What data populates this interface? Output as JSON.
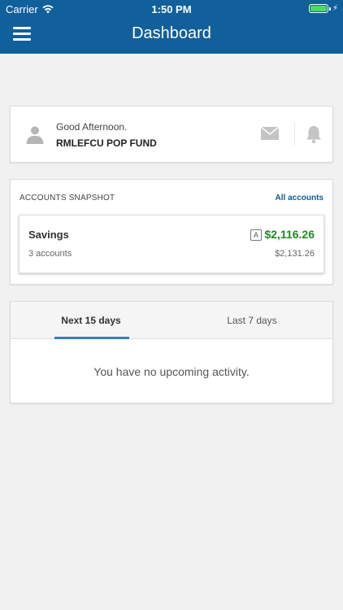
{
  "status_bar": {
    "carrier": "Carrier",
    "time": "1:50 PM",
    "battery_color": "#4cd964"
  },
  "nav": {
    "title": "Dashboard",
    "menu_icon": "hamburger-menu-icon",
    "background_color": "#11609b"
  },
  "greeting": {
    "salutation": "Good Afternoon.",
    "name": "RMLEFCU POP FUND",
    "icons": [
      "user-avatar-icon",
      "mail-icon",
      "bell-icon"
    ]
  },
  "snapshot": {
    "title": "ACCOUNTS SNAPSHOT",
    "link_label": "All accounts",
    "group": {
      "label": "Savings",
      "count": "3 accounts",
      "badge": "A",
      "available_balance": "$2,116.26",
      "current_balance": "$2,131.26",
      "balance_color": "#1f8a1f"
    }
  },
  "activity": {
    "tabs": [
      {
        "label": "Next 15 days",
        "active": true
      },
      {
        "label": "Last 7 days",
        "active": false
      }
    ],
    "empty_message": "You have no upcoming activity.",
    "accent_color": "#3a7cc1"
  }
}
